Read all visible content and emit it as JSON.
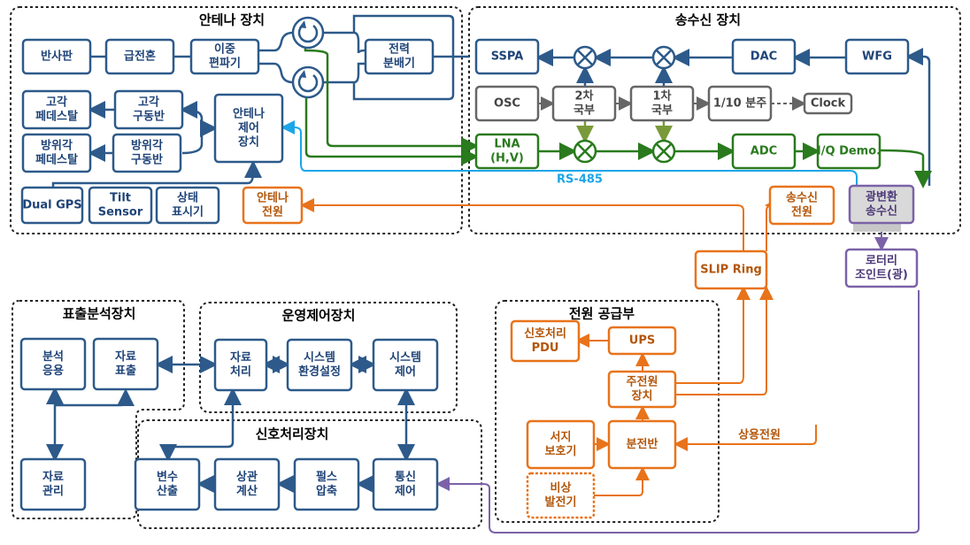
{
  "colors": {
    "blue": "#2d5a8a",
    "green": "#2a7a1e",
    "gray": "#666666",
    "orange": "#e8731a",
    "purple": "#7b62a8",
    "cyan": "#1aa6e8"
  },
  "groups": {
    "antenna": "안테나 장치",
    "transceiver": "송수신 장치",
    "display": "표출분석장치",
    "ops": "운영제어장치",
    "signal": "신호처리장치",
    "power": "전원 공급부"
  },
  "antenna": {
    "reflector": [
      "반사판"
    ],
    "feedhorn": [
      "급전혼"
    ],
    "polarizer": [
      "이중",
      "편파기"
    ],
    "divider": [
      "전력",
      "분배기"
    ],
    "el_ped": [
      "고각",
      "페데스탈"
    ],
    "el_drv": [
      "고각",
      "구동반"
    ],
    "az_ped": [
      "방위각",
      "페데스탈"
    ],
    "az_drv": [
      "방위각",
      "구동반"
    ],
    "ctrl": [
      "안테나",
      "제어",
      "장치"
    ],
    "gps": [
      "Dual GPS"
    ],
    "tilt": [
      "Tilt",
      "Sensor"
    ],
    "status": [
      "상태",
      "표시기"
    ],
    "power": [
      "안테나",
      "전원"
    ]
  },
  "trx": {
    "sspa": [
      "SSPA"
    ],
    "dac": [
      "DAC"
    ],
    "wfg": [
      "WFG"
    ],
    "osc": [
      "OSC"
    ],
    "lo2": [
      "2차",
      "국부"
    ],
    "lo1": [
      "1차",
      "국부"
    ],
    "div": [
      "1/10 분주"
    ],
    "clock": [
      "Clock"
    ],
    "lna": [
      "LNA",
      "(H,V)"
    ],
    "adc": [
      "ADC"
    ],
    "iq": [
      "I/Q Demo."
    ],
    "rs485": "RS-485",
    "power": [
      "송수신",
      "전원"
    ],
    "optical": [
      "광변환",
      "송수신"
    ],
    "slip": [
      "SLIP Ring"
    ],
    "rotary": [
      "로터리",
      "조인트(광)"
    ]
  },
  "display": {
    "app": [
      "분석",
      "응용"
    ],
    "show": [
      "자료",
      "표출"
    ],
    "mgmt": [
      "자료",
      "관리"
    ]
  },
  "ops": {
    "proc": [
      "자료",
      "처리"
    ],
    "env": [
      "시스템",
      "환경설정"
    ],
    "sys": [
      "시스템",
      "제어"
    ]
  },
  "signal": {
    "param": [
      "변수",
      "산출"
    ],
    "corr": [
      "상관",
      "계산"
    ],
    "pulse": [
      "펄스",
      "압축"
    ],
    "comm": [
      "통신",
      "제어"
    ]
  },
  "power": {
    "pdu": [
      "신호처리",
      "PDU"
    ],
    "ups": [
      "UPS"
    ],
    "main": [
      "주전원",
      "장치"
    ],
    "panel": [
      "분전반"
    ],
    "surge": [
      "서지",
      "보호기"
    ],
    "gen": [
      "비상",
      "발전기"
    ],
    "commercial": "상용전원"
  }
}
